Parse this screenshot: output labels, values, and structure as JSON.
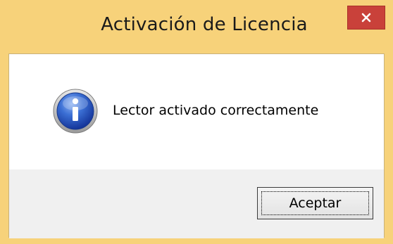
{
  "window": {
    "title": "Activación de Licencia",
    "close_icon": "close-icon",
    "colors": {
      "frame": "#f7d27a",
      "close_button": "#c9413a",
      "content_bg": "#ffffff",
      "footer_bg": "#f0f0f0"
    }
  },
  "dialog": {
    "icon": "info-icon",
    "message": "Lector activado correctamente",
    "ok_label": "Aceptar"
  }
}
